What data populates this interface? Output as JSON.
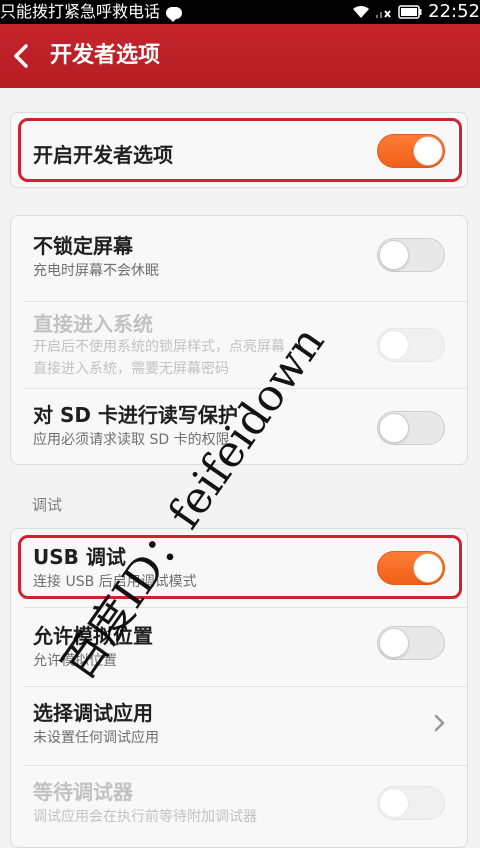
{
  "status_bar": {
    "left_text": "只能拨打紧急呼救电话",
    "time": "22:52",
    "icons": [
      "chat-icon",
      "wifi-icon",
      "signal-icon",
      "battery-icon"
    ]
  },
  "app_bar": {
    "title": "开发者选项",
    "back_icon": "chevron-left-icon",
    "color": "#c4252b"
  },
  "developer_toggle": {
    "title": "开启开发者选项",
    "enabled": true
  },
  "group1": [
    {
      "title": "不锁定屏幕",
      "subtitle": "充电时屏幕不会休眠",
      "on": false,
      "disabled": false
    },
    {
      "title": "直接进入系统",
      "subtitle_lines": [
        "开启后不使用系统的锁屏样式，点亮屏幕",
        "直接进入系统，需要无屏幕密码"
      ],
      "on": false,
      "disabled": true
    },
    {
      "title": "对 SD 卡进行读写保护",
      "subtitle": "应用必须请求读取 SD 卡的权限",
      "on": false,
      "disabled": false
    }
  ],
  "debug_section": {
    "header": "调试",
    "items": [
      {
        "title": "USB 调试",
        "subtitle": "连接 USB 后启用调试模式",
        "on": true,
        "disabled": false
      },
      {
        "title": "允许模拟位置",
        "subtitle": "允许模拟位置",
        "on": false,
        "disabled": false
      },
      {
        "title": "选择调试应用",
        "subtitle": "未设置任何调试应用",
        "chevron": true
      },
      {
        "title": "等待调试器",
        "subtitle": "调试应用会在执行前等待附加调试器",
        "on": false,
        "disabled": true
      }
    ]
  },
  "watermark": "百度ID：feifeidown",
  "accent_color": "#f0601a",
  "highlight_color": "#d1232f"
}
